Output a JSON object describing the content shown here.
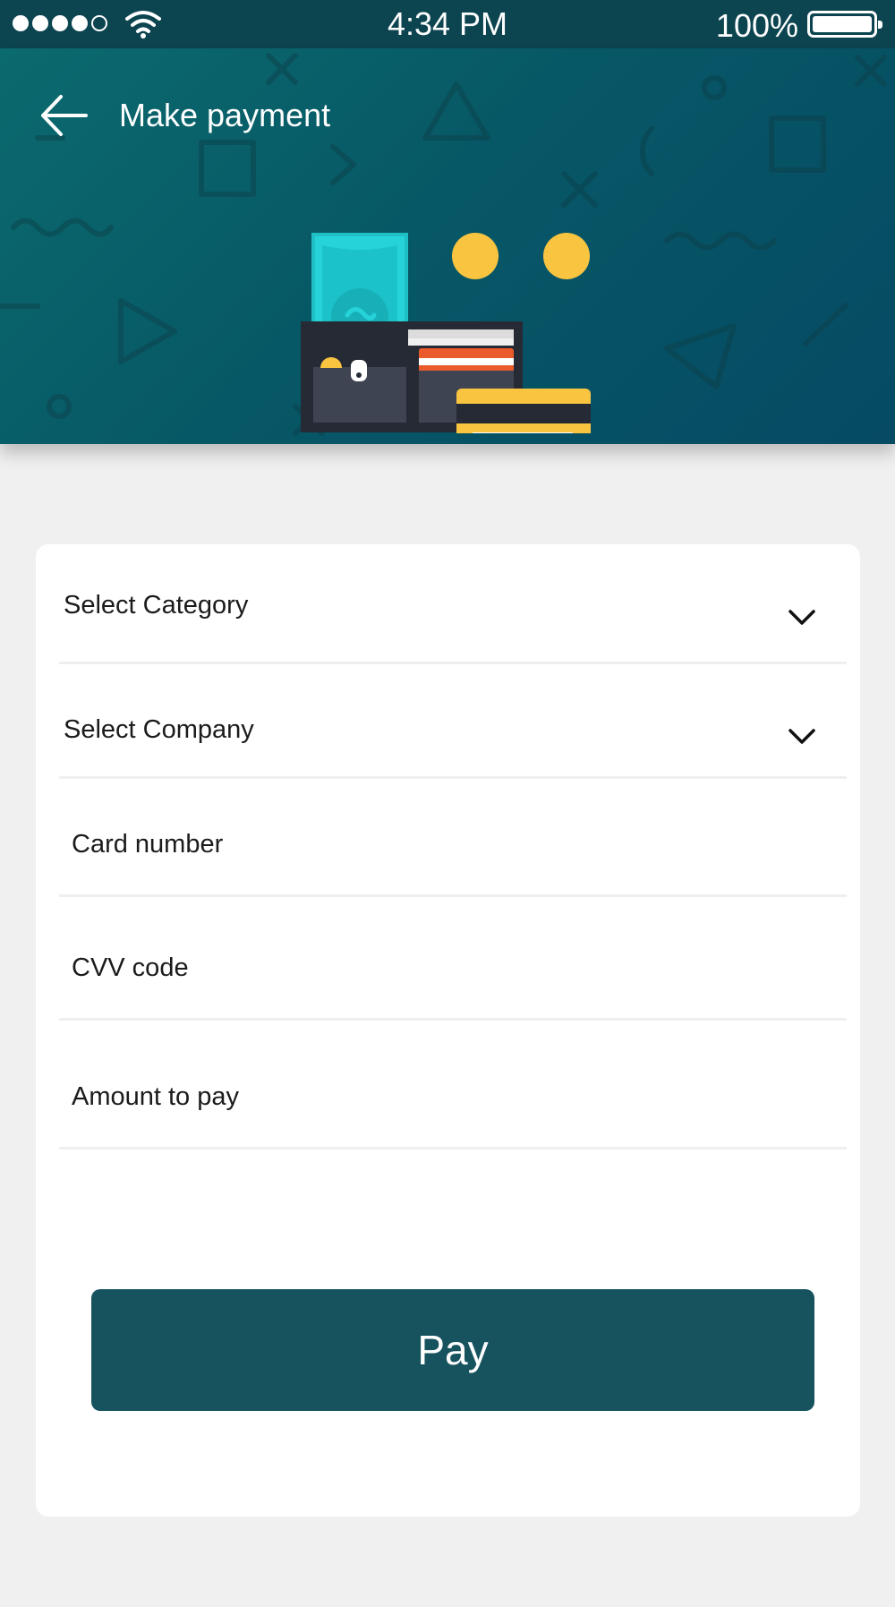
{
  "status_bar": {
    "time": "4:34 PM",
    "battery_percent": "100%",
    "signal_filled": 4,
    "signal_total": 5
  },
  "header": {
    "title": "Make payment",
    "back_icon": "arrow-left-icon",
    "illustration": "wallet-with-cash-coins-and-card"
  },
  "form": {
    "category": {
      "label": "Select Category",
      "icon": "chevron-down-icon"
    },
    "company": {
      "label": "Select Company",
      "icon": "chevron-down-icon"
    },
    "card_number": {
      "label": "Card number"
    },
    "cvv": {
      "label": "CVV code"
    },
    "amount": {
      "label": "Amount to pay"
    },
    "pay_button": "Pay"
  },
  "colors": {
    "status_bar": "#0c4450",
    "header_start": "#0b6a6e",
    "header_end": "#064a64",
    "pay_button": "#17535f",
    "background": "#f0f0f0",
    "coin": "#f9c440",
    "card": "#f9c440",
    "cash": "#26d3d9",
    "wallet": "#252a35"
  }
}
